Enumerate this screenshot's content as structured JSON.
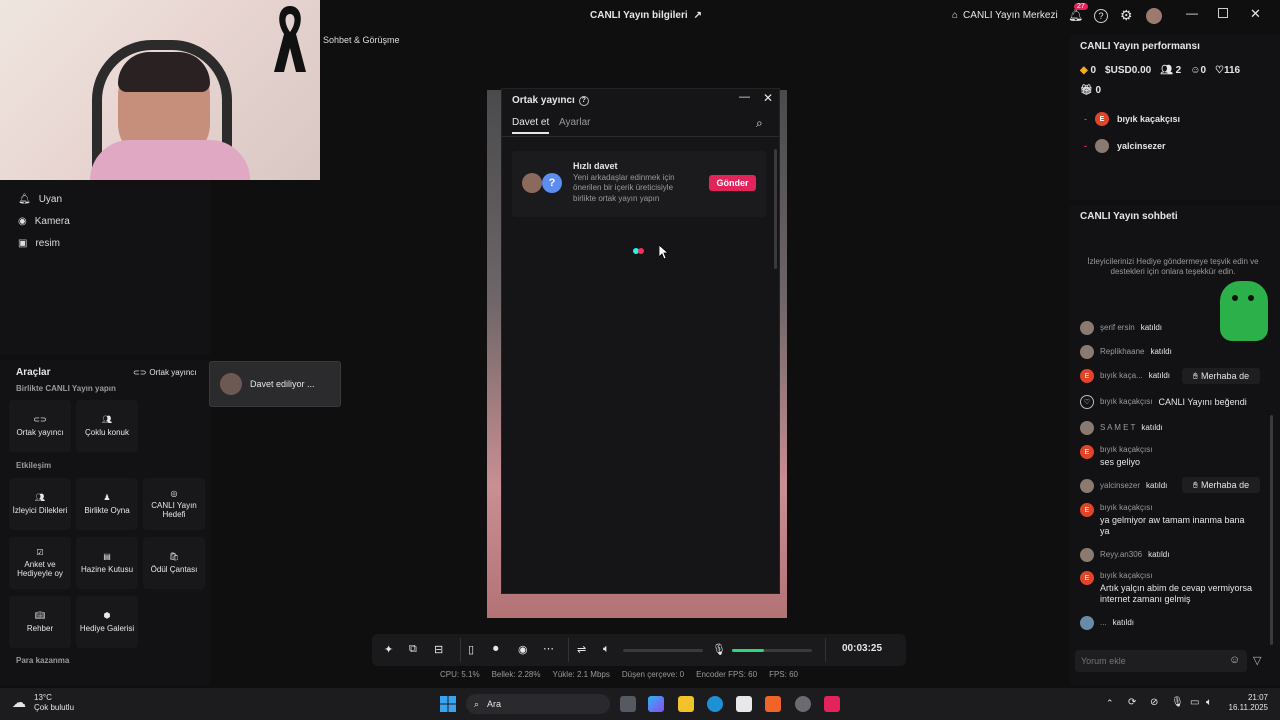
{
  "titlebar": {
    "stream_info": "CANLI Yayın bilgileri",
    "live_center": "CANLI Yayın Merkezi",
    "notif_count": "27"
  },
  "scene": {
    "label": "Sohbet & Görüşme"
  },
  "sources": [
    "Uyan",
    "Kamera",
    "resim"
  ],
  "tools": {
    "title": "Araçlar",
    "subtitle": "Birlikte CANLI Yayın yapın",
    "cohost_link": "Ortak yayıncı",
    "row1": [
      "Ortak yayıncı",
      "Çoklu konuk"
    ],
    "engagement_title": "Etkileşim",
    "row2": [
      "İzleyici Dilekleri",
      "Birlikte Oyna",
      "CANLI Yayın Hedefi"
    ],
    "row3": [
      "Anket ve Hediyeyle oy",
      "Hazine Kutusu",
      "Ödül Çantası"
    ],
    "row4": [
      "Rehber",
      "Hediye Galerisi"
    ],
    "earn_title": "Para kazanma"
  },
  "toast": {
    "text": "Davet ediliyor ..."
  },
  "modal": {
    "title": "Ortak yayıncı",
    "tabs": [
      "Davet et",
      "Ayarlar"
    ],
    "quick_title": "Hızlı davet",
    "quick_desc": "Yeni arkadaşlar edinmek için önerilen bir içerik üreticisiyle birlikte ortak yayın yapın",
    "send_label": "Gönder"
  },
  "perf": {
    "title": "CANLI Yayın performansı",
    "stats": [
      "0",
      "USD0.00",
      "2",
      "0",
      "116"
    ],
    "gift": "0",
    "viewers": [
      {
        "avatar": "E",
        "name": "bıyık kaçakçısı"
      },
      {
        "avatar": "",
        "name": "yalcinsezer"
      }
    ]
  },
  "chat": {
    "title": "CANLI Yayın sohbeti",
    "tip": "İzleyicilerinizi Hediye göndermeye teşvik edin ve destekleri için onlara teşekkür edin.",
    "messages": [
      {
        "user": "şerif ersin",
        "text": "katıldı",
        "action": ""
      },
      {
        "user": "Replikhaane",
        "text": "katıldı",
        "action": ""
      },
      {
        "user": "bıyık kaça...",
        "text": "katıldı",
        "action": "Merhaba de"
      },
      {
        "user": "bıyık kaçakçısı",
        "text": "CANLI Yayını beğendi",
        "action": ""
      },
      {
        "user": "S A M E T",
        "text": "katıldı",
        "action": ""
      },
      {
        "user": "bıyık kaçakçısı",
        "text": "ses geliyo",
        "action": ""
      },
      {
        "user": "yalcinsezer",
        "text": "katıldı",
        "action": "Merhaba de"
      },
      {
        "user": "bıyık kaçakçısı",
        "text": "ya gelmiyor aw tamam inanma bana ya",
        "action": ""
      },
      {
        "user": "Reyy.an306",
        "text": "katıldı",
        "action": ""
      },
      {
        "user": "bıyık kaçakçısı",
        "text": "Artık yalçın abim de cevap vermiyorsa internet zamanı gelmiş",
        "action": ""
      },
      {
        "user": "...",
        "text": "katıldı",
        "action": ""
      }
    ],
    "comment_placeholder": "Yorum ekle"
  },
  "controls": {
    "timer": "00:03:25",
    "volume_level": 0.4
  },
  "stats": {
    "cpu": "CPU: 5.1%",
    "memory": "Bellek: 2.28%",
    "upload": "Yükle: 2.1 Mbps",
    "dropped": "Düşen çerçeve: 0",
    "encoder_fps": "Encoder FPS: 60",
    "fps": "FPS: 60"
  },
  "taskbar": {
    "temp": "13°C",
    "weather": "Çok bulutlu",
    "search": "Ara",
    "time": "21:07",
    "date": "16.11.2025"
  },
  "colors": {
    "accent": "#e3245b",
    "volume": "#2fd67a"
  }
}
